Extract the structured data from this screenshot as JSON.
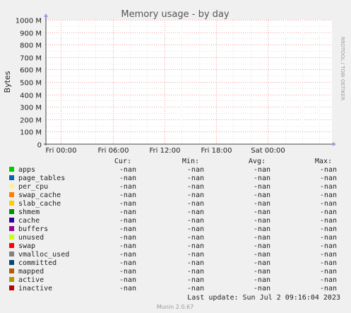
{
  "chart_data": {
    "type": "line",
    "title": "Memory usage - by day",
    "ylabel": "Bytes",
    "ylim": [
      0,
      1000000000
    ],
    "yticks": [
      {
        "value": 0,
        "label": "0"
      },
      {
        "value": 100000000,
        "label": "100 M"
      },
      {
        "value": 200000000,
        "label": "200 M"
      },
      {
        "value": 300000000,
        "label": "300 M"
      },
      {
        "value": 400000000,
        "label": "400 M"
      },
      {
        "value": 500000000,
        "label": "500 M"
      },
      {
        "value": 600000000,
        "label": "600 M"
      },
      {
        "value": 700000000,
        "label": "700 M"
      },
      {
        "value": 800000000,
        "label": "800 M"
      },
      {
        "value": 900000000,
        "label": "900 M"
      },
      {
        "value": 1000000000,
        "label": "1000 M"
      }
    ],
    "xticks": [
      "Fri 00:00",
      "Fri 06:00",
      "Fri 12:00",
      "Fri 18:00",
      "Sat 00:00"
    ],
    "grid": true,
    "side_label": "RRDTOOL / TOBI OETIKER",
    "columns": [
      "Cur:",
      "Min:",
      "Avg:",
      "Max:"
    ],
    "series": [
      {
        "name": "apps",
        "color": "#00cc00",
        "values": [
          "-nan",
          "-nan",
          "-nan",
          "-nan"
        ]
      },
      {
        "name": "page_tables",
        "color": "#0066b3",
        "values": [
          "-nan",
          "-nan",
          "-nan",
          "-nan"
        ]
      },
      {
        "name": "per_cpu",
        "color": "#ffeea0",
        "values": [
          "-nan",
          "-nan",
          "-nan",
          "-nan"
        ]
      },
      {
        "name": "swap_cache",
        "color": "#ff8000",
        "values": [
          "-nan",
          "-nan",
          "-nan",
          "-nan"
        ]
      },
      {
        "name": "slab_cache",
        "color": "#ffcc00",
        "values": [
          "-nan",
          "-nan",
          "-nan",
          "-nan"
        ]
      },
      {
        "name": "shmem",
        "color": "#008f00",
        "values": [
          "-nan",
          "-nan",
          "-nan",
          "-nan"
        ]
      },
      {
        "name": "cache",
        "color": "#330099",
        "values": [
          "-nan",
          "-nan",
          "-nan",
          "-nan"
        ]
      },
      {
        "name": "buffers",
        "color": "#990099",
        "values": [
          "-nan",
          "-nan",
          "-nan",
          "-nan"
        ]
      },
      {
        "name": "unused",
        "color": "#ccff00",
        "values": [
          "-nan",
          "-nan",
          "-nan",
          "-nan"
        ]
      },
      {
        "name": "swap",
        "color": "#ff0000",
        "values": [
          "-nan",
          "-nan",
          "-nan",
          "-nan"
        ]
      },
      {
        "name": "vmalloc_used",
        "color": "#808080",
        "values": [
          "-nan",
          "-nan",
          "-nan",
          "-nan"
        ]
      },
      {
        "name": "committed",
        "color": "#004b73",
        "values": [
          "-nan",
          "-nan",
          "-nan",
          "-nan"
        ]
      },
      {
        "name": "mapped",
        "color": "#b35c00",
        "values": [
          "-nan",
          "-nan",
          "-nan",
          "-nan"
        ]
      },
      {
        "name": "active",
        "color": "#b39600",
        "values": [
          "-nan",
          "-nan",
          "-nan",
          "-nan"
        ]
      },
      {
        "name": "inactive",
        "color": "#c00000",
        "values": [
          "-nan",
          "-nan",
          "-nan",
          "-nan"
        ]
      }
    ],
    "last_update": "Last update: Sun Jul  2 09:16:04 2023",
    "footer": "Munin 2.0.67"
  }
}
